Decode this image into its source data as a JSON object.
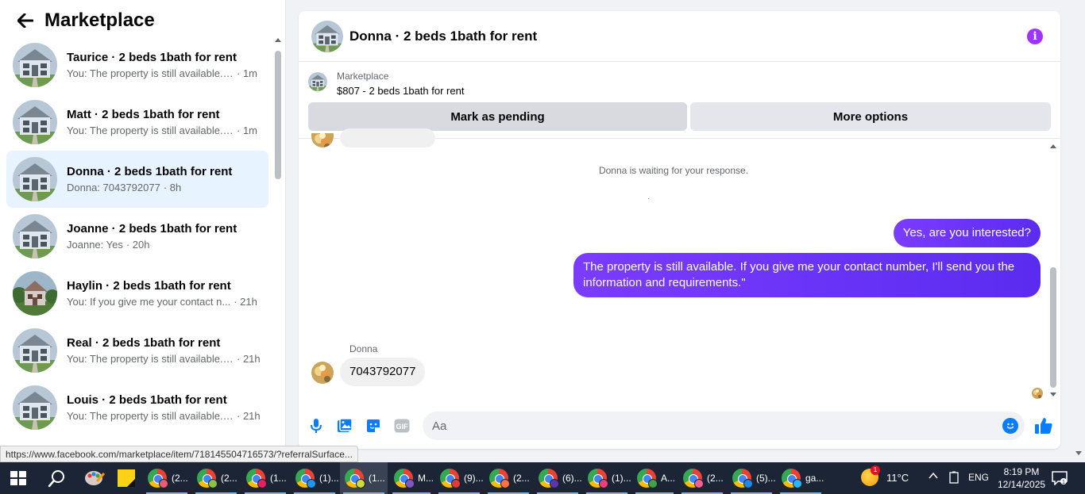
{
  "sidebar": {
    "title": "Marketplace",
    "conversations": [
      {
        "name": "Taurice · 2 beds 1bath for rent",
        "snippet": "You: The property is still available. I...",
        "time": "· 1m",
        "active": false
      },
      {
        "name": "Matt · 2 beds 1bath for rent",
        "snippet": "You: The property is still available. I...",
        "time": "· 1m",
        "active": false
      },
      {
        "name": "Donna · 2 beds 1bath for rent",
        "snippet": "Donna: 7043792077",
        "time": "· 8h",
        "active": true
      },
      {
        "name": "Joanne · 2 beds 1bath for rent",
        "snippet": "Joanne: Yes",
        "time": "· 20h",
        "active": false
      },
      {
        "name": "Haylin · 2 beds 1bath for rent",
        "snippet": "You: If you give me your contact n...",
        "time": "· 21h",
        "active": false
      },
      {
        "name": "Real · 2 beds 1bath for rent",
        "snippet": "You: The property is still available. ...",
        "time": "· 21h",
        "active": false
      },
      {
        "name": "Louis · 2 beds 1bath for rent",
        "snippet": "You: The property is still available. ...",
        "time": "· 21h",
        "active": false
      }
    ]
  },
  "status_url": "https://www.facebook.com/marketplace/item/718145504716573/?referralSurface...",
  "chat": {
    "title": "Donna · 2 beds 1bath for rent",
    "listing": {
      "label": "Marketplace",
      "price_title": "$807 - 2 beds 1bath for rent"
    },
    "buttons": {
      "pending": "Mark as pending",
      "more": "More options"
    },
    "waiting_text": "Donna is waiting for your response.",
    "messages": {
      "out1": "Yes, are you interested?",
      "out2": "The property is still available. If you give me your contact number, I'll send you the information and requirements.\"",
      "sender": "Donna",
      "in1": "7043792077"
    },
    "composer": {
      "placeholder": "Aa"
    }
  },
  "taskbar": {
    "tasks": [
      {
        "label": "(2...",
        "badge_color": "#e85d75",
        "active": false
      },
      {
        "label": "(2...",
        "badge_color": "#8bc34a",
        "active": false
      },
      {
        "label": "(1...",
        "badge_color": "#e91e63",
        "active": false
      },
      {
        "label": "(1)...",
        "badge_color": "#2196f3",
        "active": false
      },
      {
        "label": "(1...",
        "badge_color": "#cddc39",
        "active": true
      },
      {
        "label": "M...",
        "badge_color": "#7e57c2",
        "active": false
      },
      {
        "label": "(9)...",
        "badge_color": "#e53935",
        "active": false
      },
      {
        "label": "(2...",
        "badge_color": "#ff7043",
        "active": false
      },
      {
        "label": "(6)...",
        "badge_color": "#5e35b1",
        "active": false
      },
      {
        "label": "(1)...",
        "badge_color": "#ec407a",
        "active": false
      },
      {
        "label": "A...",
        "badge_color": "#43a047",
        "active": false
      },
      {
        "label": "(2...",
        "badge_color": "#f06292",
        "active": false
      },
      {
        "label": "(5)...",
        "badge_color": "#1e88e5",
        "active": false
      },
      {
        "label": "ga...",
        "badge_color": "#29b6f6",
        "active": false
      }
    ],
    "weather_badge": "1",
    "temperature": "11°C",
    "language": "ENG",
    "time": "8:19 PM",
    "date": "12/14/2025"
  },
  "colors": {
    "accent": "#7b3cff",
    "info": "#a033ff",
    "active_conv": "#e7f3ff",
    "messenger_blue": "#0a7cff",
    "taskbar": "#1c2536"
  }
}
